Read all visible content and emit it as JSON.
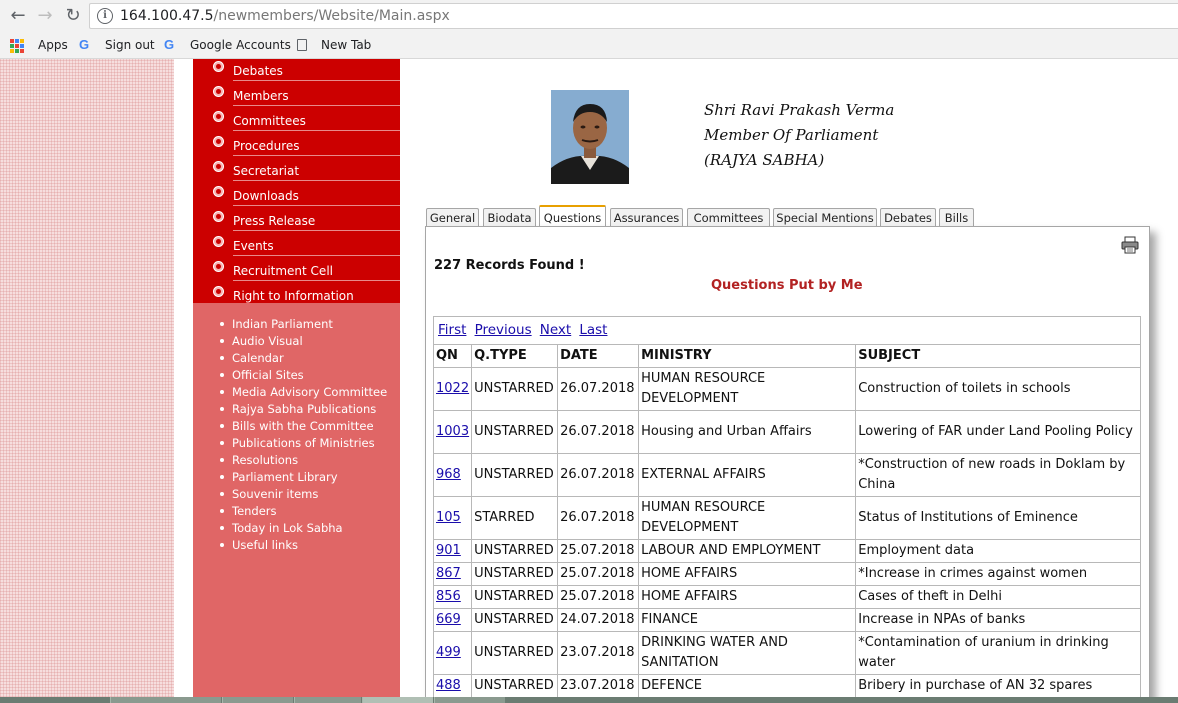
{
  "browser": {
    "url_host": "164.100.47.5",
    "url_path": "/newmembers/Website/Main.aspx",
    "bookmarks": [
      {
        "label": "Apps",
        "icon": "apps-grid-icon"
      },
      {
        "label": "Sign out",
        "icon": "google-icon"
      },
      {
        "label": "Google Accounts",
        "icon": "google-icon"
      },
      {
        "label": "New Tab",
        "icon": "page-icon"
      }
    ]
  },
  "leftnav": {
    "main_items": [
      "Debates",
      "Members",
      "Committees",
      "Procedures",
      "Secretariat",
      "Downloads",
      "Press Release",
      "Events",
      "Recruitment Cell",
      "Right to Information"
    ],
    "sub_links": [
      "Indian Parliament",
      "Audio Visual",
      "Calendar",
      "Official Sites",
      "Media Advisory Committee",
      "Rajya Sabha Publications",
      "Bills with the Committee",
      "Publications of Ministries",
      "Resolutions",
      "Parliament Library",
      "Souvenir items",
      "Tenders",
      "Today in Lok Sabha",
      "Useful links"
    ]
  },
  "member": {
    "name": "Shri Ravi Prakash Verma",
    "role": "Member Of Parliament",
    "house": "(RAJYA SABHA)"
  },
  "tabs": [
    "General",
    "Biodata",
    "Questions",
    "Assurances",
    "Committees",
    "Special Mentions",
    "Debates",
    "Bills"
  ],
  "active_tab": "Questions",
  "content": {
    "records_found": "227 Records Found !",
    "section_title": "Questions Put by Me",
    "pager": [
      "First",
      "Previous",
      "Next",
      "Last"
    ],
    "columns": [
      "QN",
      "Q.TYPE",
      "DATE",
      "MINISTRY",
      "SUBJECT"
    ],
    "rows": [
      {
        "qn": "1022",
        "type": "UNSTARRED",
        "date": "26.07.2018",
        "ministry": "HUMAN RESOURCE DEVELOPMENT",
        "subject": "Construction of toilets in schools"
      },
      {
        "qn": "1003",
        "type": "UNSTARRED",
        "date": "26.07.2018",
        "ministry": "Housing and Urban Affairs",
        "subject": "Lowering of FAR under Land Pooling Policy"
      },
      {
        "qn": "968",
        "type": "UNSTARRED",
        "date": "26.07.2018",
        "ministry": "EXTERNAL AFFAIRS",
        "subject": "*Construction of new roads in Doklam by China"
      },
      {
        "qn": "105",
        "type": "STARRED",
        "date": "26.07.2018",
        "ministry": "HUMAN RESOURCE DEVELOPMENT",
        "subject": "Status of Institutions of Eminence"
      },
      {
        "qn": "901",
        "type": "UNSTARRED",
        "date": "25.07.2018",
        "ministry": "LABOUR AND EMPLOYMENT",
        "subject": "Employment data"
      },
      {
        "qn": "867",
        "type": "UNSTARRED",
        "date": "25.07.2018",
        "ministry": "HOME AFFAIRS",
        "subject": "*Increase in crimes against women"
      },
      {
        "qn": "856",
        "type": "UNSTARRED",
        "date": "25.07.2018",
        "ministry": "HOME AFFAIRS",
        "subject": "Cases of theft in Delhi"
      },
      {
        "qn": "669",
        "type": "UNSTARRED",
        "date": "24.07.2018",
        "ministry": "FINANCE",
        "subject": "Increase in NPAs of banks"
      },
      {
        "qn": "499",
        "type": "UNSTARRED",
        "date": "23.07.2018",
        "ministry": "DRINKING WATER AND SANITATION",
        "subject": "*Contamination of uranium in drinking water"
      },
      {
        "qn": "488",
        "type": "UNSTARRED",
        "date": "23.07.2018",
        "ministry": "DEFENCE",
        "subject": "Bribery in purchase of AN 32 spares"
      }
    ]
  },
  "colors": {
    "menu_red": "#cc0000",
    "sublink_red": "#e06666",
    "title_red": "#b22222",
    "link_blue": "#1a0dab",
    "active_tab_accent": "#e8a000"
  }
}
